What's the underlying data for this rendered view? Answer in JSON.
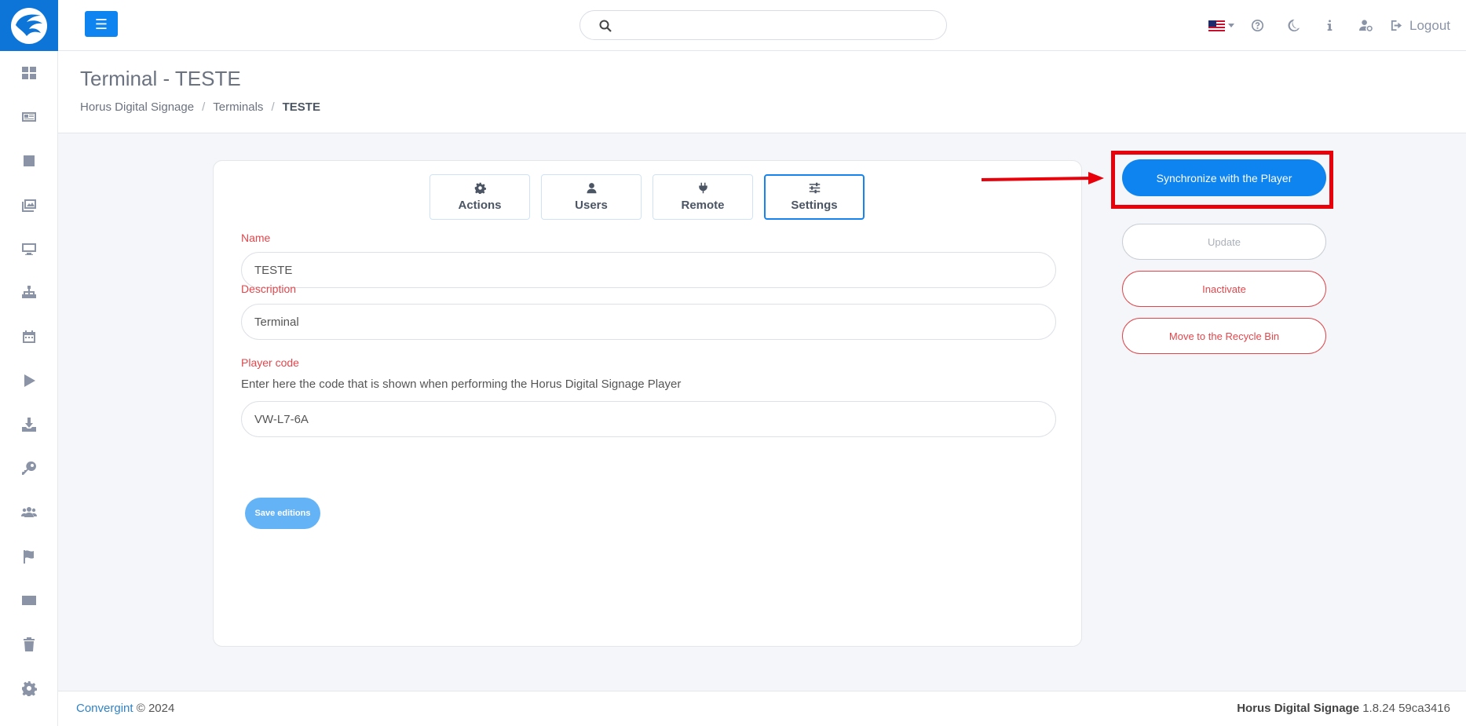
{
  "sidebar": {
    "items": [
      {
        "icon": "dashboard-icon"
      },
      {
        "icon": "news-icon"
      },
      {
        "icon": "inbox-icon"
      },
      {
        "icon": "images-icon"
      },
      {
        "icon": "monitor-icon"
      },
      {
        "icon": "sitemap-icon"
      },
      {
        "icon": "calendar-icon"
      },
      {
        "icon": "play-icon"
      },
      {
        "icon": "download-icon"
      },
      {
        "icon": "key-icon"
      },
      {
        "icon": "users-icon"
      },
      {
        "icon": "flag-icon"
      },
      {
        "icon": "credit-card-icon"
      },
      {
        "icon": "trash-icon"
      },
      {
        "icon": "settings-gear-icon"
      }
    ]
  },
  "topbar": {
    "search_placeholder": "",
    "logout_label": "Logout"
  },
  "header": {
    "title": "Terminal - TESTE",
    "breadcrumb": [
      "Horus Digital Signage",
      "Terminals",
      "TESTE"
    ]
  },
  "tabs": [
    {
      "label": "Actions",
      "icon": "gear-icon"
    },
    {
      "label": "Users",
      "icon": "user-icon"
    },
    {
      "label": "Remote",
      "icon": "plug-icon"
    },
    {
      "label": "Settings",
      "icon": "sliders-icon",
      "active": true
    }
  ],
  "form": {
    "name_label": "Name",
    "name_value": "TESTE",
    "description_label": "Description",
    "description_value": "Terminal",
    "player_code_label": "Player code",
    "player_code_help": "Enter here the code that is shown when performing the Horus Digital Signage Player",
    "player_code_value": "VW-L7-6A",
    "save_label": "Save editions"
  },
  "actions": {
    "sync_label": "Synchronize with the Player",
    "update_label": "Update",
    "inactivate_label": "Inactivate",
    "recycle_label": "Move to the Recycle Bin"
  },
  "footer": {
    "brand": "Convergint",
    "copyright": "© 2024",
    "product": "Horus Digital Signage",
    "version": "1.8.24 59ca3416"
  },
  "colors": {
    "primary": "#0d84f0",
    "danger": "#e0474c",
    "highlight": "#e8000b"
  }
}
